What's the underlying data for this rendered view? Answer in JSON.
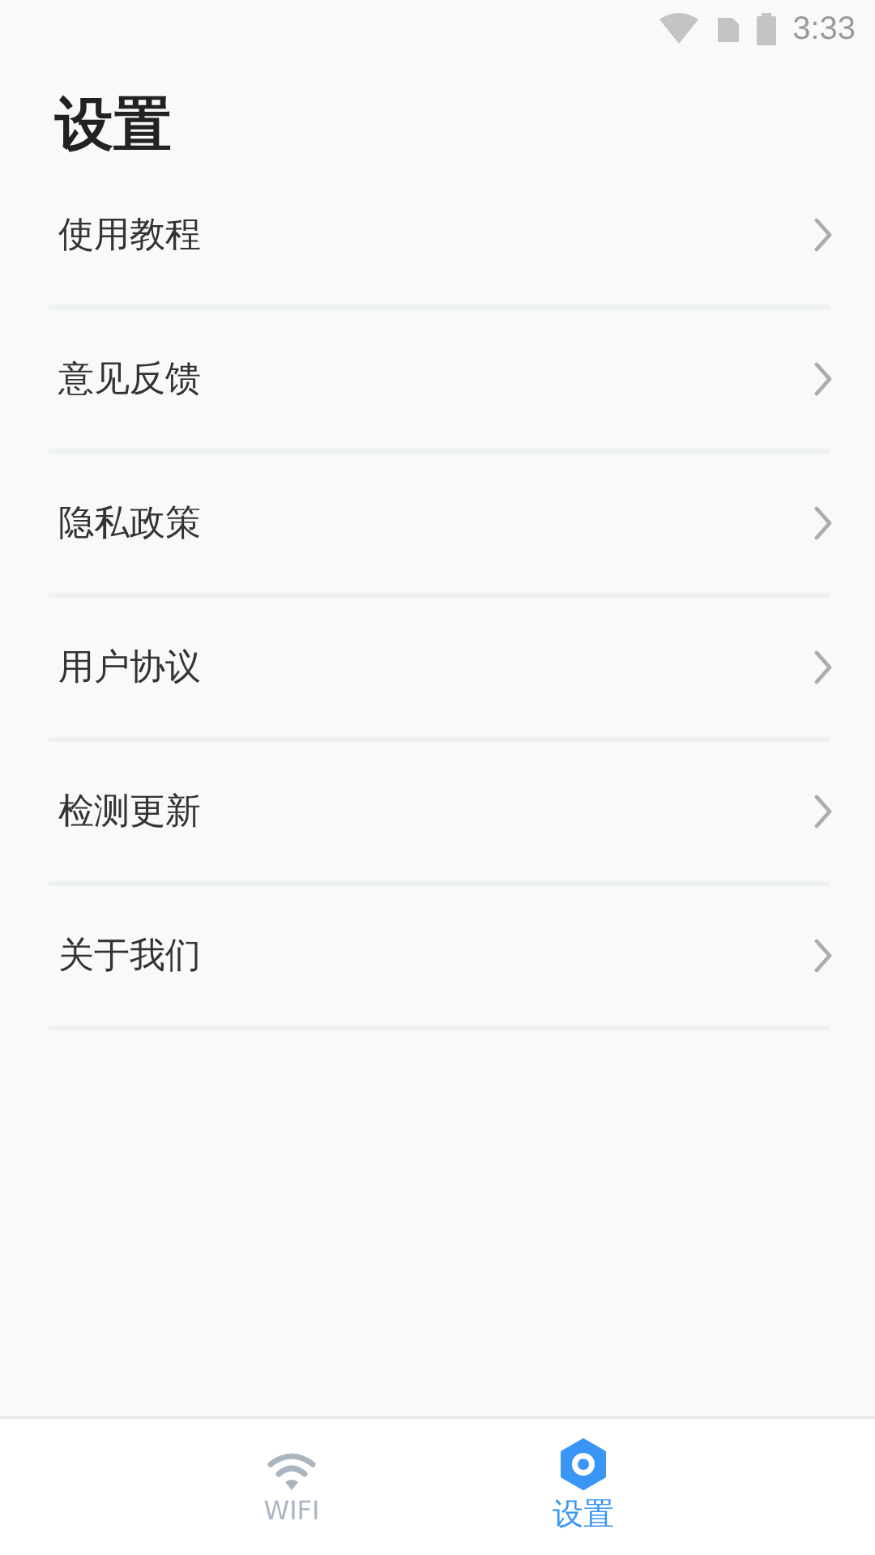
{
  "status_bar": {
    "time": "3:33"
  },
  "title": "设置",
  "items": [
    {
      "label": "使用教程"
    },
    {
      "label": "意见反馈"
    },
    {
      "label": "隐私政策"
    },
    {
      "label": "用户协议"
    },
    {
      "label": "检测更新"
    },
    {
      "label": "关于我们"
    }
  ],
  "tabs": [
    {
      "kind": "wifi",
      "label": "WIFI",
      "selected": false
    },
    {
      "kind": "settings",
      "label": "设置",
      "selected": true
    }
  ]
}
